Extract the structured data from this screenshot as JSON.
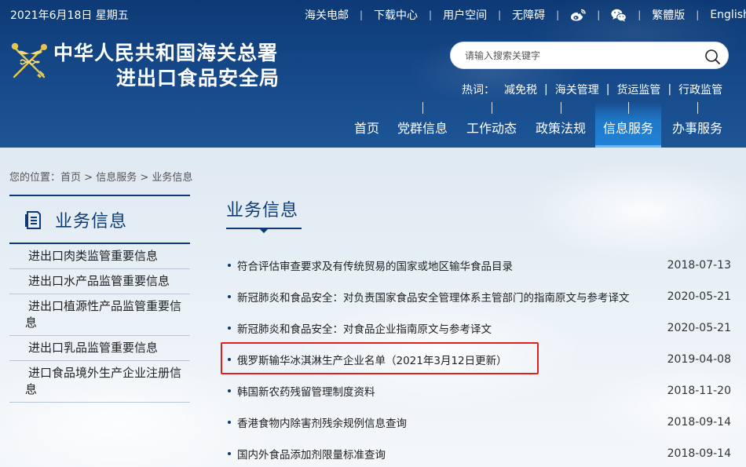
{
  "top": {
    "date": "2021年6月18日 星期五",
    "links": [
      "海关电邮",
      "下载中心",
      "用户空间",
      "无障碍"
    ],
    "icons": [
      "weibo-icon",
      "wechat-icon"
    ],
    "lang_links": [
      "繁體版",
      "English"
    ]
  },
  "site": {
    "title_line1": "中华人民共和国海关总署",
    "title_line2": "进出口食品安全局"
  },
  "search": {
    "placeholder": "请输入搜索关键字"
  },
  "hot": {
    "label": "热词：",
    "words": [
      "减免税",
      "海关管理",
      "货运监管",
      "行政监管"
    ]
  },
  "nav": {
    "items": [
      "首页",
      "党群信息",
      "工作动态",
      "政策法规",
      "信息服务",
      "办事服务"
    ],
    "active_index": 4
  },
  "breadcrumb": {
    "prefix": "您的位置：",
    "items": [
      "首页",
      "信息服务",
      "业务信息"
    ],
    "separator": " > "
  },
  "sidebar": {
    "title": "业务信息",
    "items": [
      "进出口肉类监管重要信息",
      "进出口水产品监管重要信息",
      "进出口植源性产品监管重要信息",
      "进出口乳品监管重要信息",
      "进口食品境外生产企业注册信息"
    ]
  },
  "main": {
    "title": "业务信息",
    "highlighted_index": 3,
    "news": [
      {
        "title": "符合评估审查要求及有传统贸易的国家或地区输华食品目录",
        "date": "2018-07-13"
      },
      {
        "title": "新冠肺炎和食品安全：对负责国家食品安全管理体系主管部门的指南原文与参考译文",
        "date": "2020-05-21"
      },
      {
        "title": "新冠肺炎和食品安全：对食品企业指南原文与参考译文",
        "date": "2020-05-21"
      },
      {
        "title": "俄罗斯输华冰淇淋生产企业名单（2021年3月12日更新）",
        "date": "2019-04-08"
      },
      {
        "title": "韩国新农药残留管理制度资料",
        "date": "2018-11-20"
      },
      {
        "title": "香港食物内除害剂残余规例信息查询",
        "date": "2018-09-14"
      },
      {
        "title": "国内外食品添加剂限量标准查询",
        "date": "2018-09-14"
      }
    ]
  },
  "colors": {
    "header_dark": "#0d3a76",
    "nav_active": "#2283d6",
    "highlight": "#e02020"
  }
}
